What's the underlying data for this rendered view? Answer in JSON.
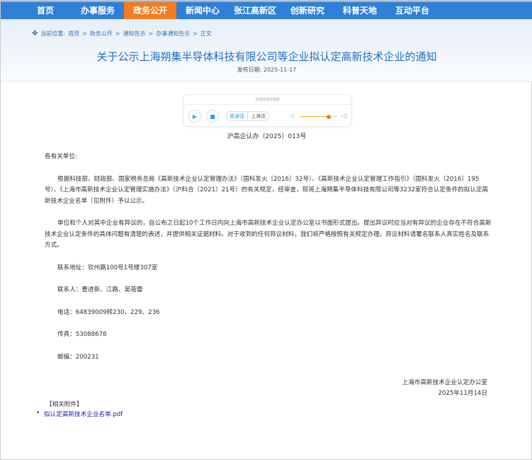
{
  "nav": [
    "首页",
    "办事服务",
    "政务公开",
    "新闻中心",
    "张江高新区",
    "创新研究",
    "科普天地",
    "互动平台"
  ],
  "nav_active": 2,
  "breadcrumb": {
    "label": "当前位置:",
    "items": [
      "首页",
      "政务公开",
      "通知告示",
      "办事通知告示",
      "正文"
    ]
  },
  "title": "关于公示上海朔集半导体科技有限公司等企业拟认定高新技术企业的通知",
  "publish_date": "发布日期: 2025-11-17",
  "player": {
    "caption": "无障碍语音播报",
    "lang_on": "普通话",
    "lang_off": "上海话",
    "volume": 0.75
  },
  "doc_number": "沪高企认办（2025）013号",
  "salutation": "各有关单位:",
  "para1": "根据科技部、财政部、国家税务总局《高新技术企业认定管理办法》（国科发火〔2016〕32号）、《高新技术企业认定管理工作指引》（国科发火〔2016〕195号）、《上海市高新技术企业认定管理实施办法》（沪科合〔2021〕21号）的有关规定，经审查，现将上海朔集半导体科技有限公司等3232家符合认定条件的拟认定高新技术企业名单（见附件）予以公示。",
  "para2": "单位和个人对其中企业有异议的，自公布之日起10个工作日内向上海市高新技术企业认定办公室以书面形式提出。提出异议时应当对有异议的企业存在不符合高新技术企业认定条件的具体问题有清楚的表述，并提供相关证据材料。对于收到的任何异议材料，我们将严格按照有关规定办理。异议材料请署名联系人真实姓名及联系方式。",
  "contacts": [
    "联系地址：钦州路100号1号楼307室",
    "联系人：曹进新、江路、吴蓓蕾",
    "电话：64839009转230、229、236",
    "传真：53088678",
    "邮编：200231"
  ],
  "signature": {
    "org": "上海市高新技术企业认定办公室",
    "date": "2025年11月14日"
  },
  "attachments": {
    "heading": "【相关附件】",
    "items": [
      "拟认定高新技术企业名单.pdf"
    ]
  }
}
